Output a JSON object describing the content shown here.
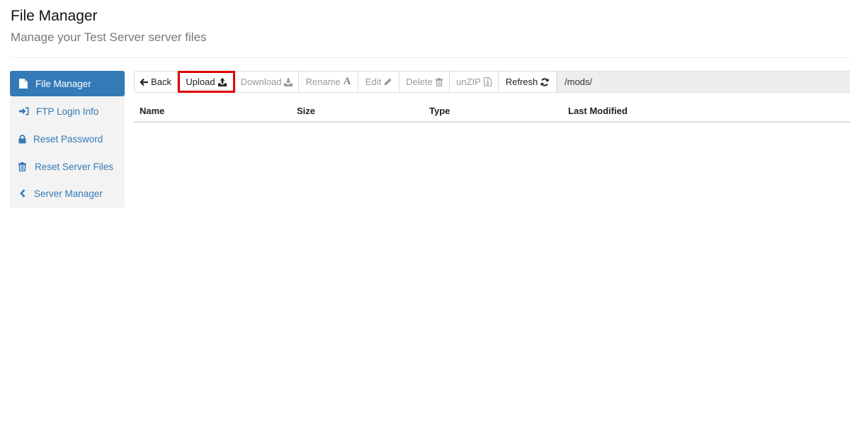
{
  "header": {
    "title": "File Manager",
    "subtitle": "Manage your Test Server server files"
  },
  "sidebar": {
    "items": [
      {
        "label": "File Manager",
        "icon": "file-icon",
        "active": true
      },
      {
        "label": "FTP Login Info",
        "icon": "sign-in-icon",
        "active": false
      },
      {
        "label": "Reset Password",
        "icon": "lock-icon",
        "active": false
      },
      {
        "label": "Reset Server Files",
        "icon": "trash-icon",
        "active": false
      },
      {
        "label": "Server Manager",
        "icon": "chevron-left-icon",
        "active": false
      }
    ]
  },
  "toolbar": {
    "buttons": [
      {
        "label": "Back",
        "icon": "arrow-left-icon",
        "enabled": true
      },
      {
        "label": "Upload",
        "icon": "upload-icon",
        "enabled": true,
        "highlighted": true
      },
      {
        "label": "Download",
        "icon": "download-icon",
        "enabled": false
      },
      {
        "label": "Rename",
        "icon": "font-icon",
        "enabled": false
      },
      {
        "label": "Edit",
        "icon": "pencil-icon",
        "enabled": false
      },
      {
        "label": "Delete",
        "icon": "trash-icon",
        "enabled": false
      },
      {
        "label": "unZIP",
        "icon": "file-zip-icon",
        "enabled": false
      },
      {
        "label": "Refresh",
        "icon": "refresh-icon",
        "enabled": true
      }
    ],
    "current_path": "/mods/",
    "highlight_color": "#e00000"
  },
  "table": {
    "columns": [
      "Name",
      "Size",
      "Type",
      "Last Modified"
    ],
    "rows": []
  },
  "colors": {
    "accent": "#337ab7",
    "sidebar_bg": "#f3f3f3",
    "path_bg": "#eeeeee"
  }
}
